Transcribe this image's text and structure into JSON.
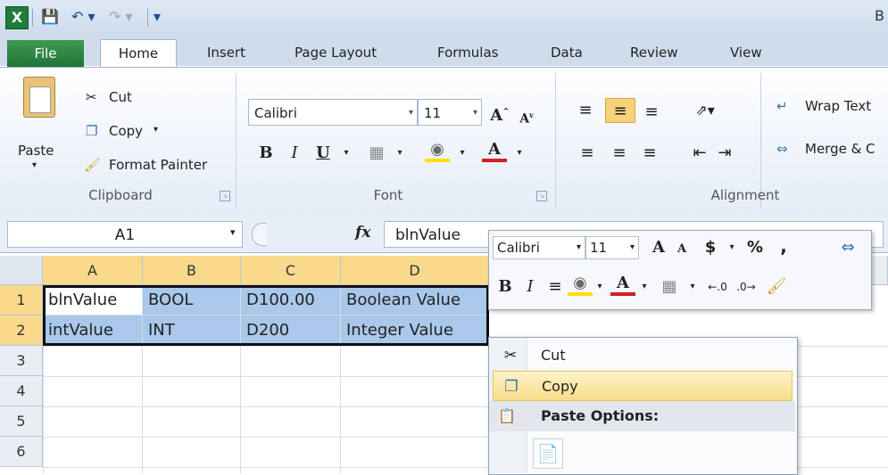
{
  "window": {
    "title_partial": "B"
  },
  "tabs": [
    "File",
    "Home",
    "Insert",
    "Page Layout",
    "Formulas",
    "Data",
    "Review",
    "View"
  ],
  "ribbon": {
    "clipboard": {
      "paste": "Paste",
      "cut": "Cut",
      "copy": "Copy",
      "format_painter": "Format Painter",
      "label": "Clipboard"
    },
    "font": {
      "name": "Calibri",
      "size": "11",
      "bold": "B",
      "italic": "I",
      "underline": "U",
      "font_color_letter": "A",
      "label": "Font"
    },
    "alignment": {
      "wrap_text": "Wrap Text",
      "merge": "Merge & C",
      "label": "Alignment"
    }
  },
  "formula_bar": {
    "name_box": "A1",
    "fx": "fx",
    "value": "blnValue"
  },
  "sheet": {
    "columns": [
      "A",
      "B",
      "C",
      "D"
    ],
    "rows": [
      "1",
      "2",
      "3",
      "4",
      "5",
      "6"
    ],
    "cells": [
      [
        "blnValue",
        "BOOL",
        "D100.00",
        "Boolean Value"
      ],
      [
        "intValue",
        "INT",
        "D200",
        "Integer Value"
      ]
    ]
  },
  "mini_toolbar": {
    "font": "Calibri",
    "size": "11",
    "currency": "$",
    "percent": "%",
    "comma": ",",
    "bold": "B",
    "italic": "I",
    "font_color_letter": "A"
  },
  "context_menu": {
    "cut": "Cut",
    "copy": "Copy",
    "paste_options": "Paste Options:"
  },
  "colors": {
    "selection": "#a9c8ea",
    "header_selected": "#f9d98b",
    "file_tab": "#2a8544",
    "highlight": "#f8dc8a"
  }
}
